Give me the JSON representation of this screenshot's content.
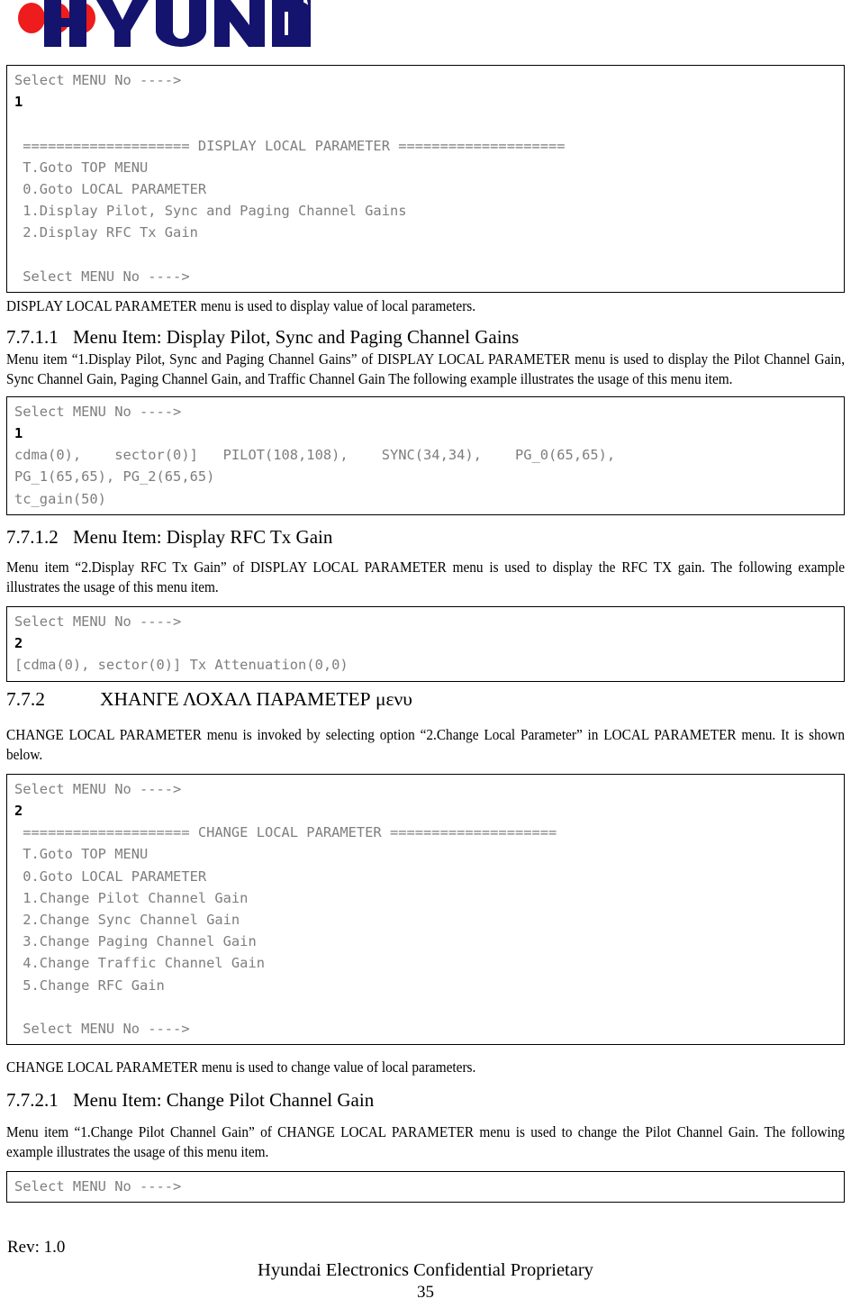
{
  "logo": {
    "wordmark": "HYUNDAI",
    "navy": "#14136e",
    "red": "#ee1c1c"
  },
  "terminal1": {
    "lines": [
      {
        "text": "Select MENU No ---->",
        "style": "dim"
      },
      {
        "text": "1",
        "style": "entry"
      },
      {
        "text": "",
        "style": "dim"
      },
      {
        "text": " ==================== DISPLAY LOCAL PARAMETER ====================",
        "style": "dim"
      },
      {
        "text": " T.Goto TOP MENU",
        "style": "dim"
      },
      {
        "text": " 0.Goto LOCAL PARAMETER",
        "style": "dim"
      },
      {
        "text": " 1.Display Pilot, Sync and Paging Channel Gains",
        "style": "dim"
      },
      {
        "text": " 2.Display RFC Tx Gain",
        "style": "dim"
      },
      {
        "text": "",
        "style": "dim"
      },
      {
        "text": " Select MENU No ---->",
        "style": "dim"
      }
    ]
  },
  "para1": "DISPLAY LOCAL PARAMETER menu is used to display value of local parameters.",
  "heading_7711": {
    "number": "7.7.1.1",
    "title": "Menu Item: Display Pilot, Sync and Paging Channel Gains"
  },
  "para2": "Menu item “1.Display Pilot, Sync and Paging Channel Gains” of DISPLAY LOCAL PARAMETER menu is used to display the Pilot Channel Gain, Sync Channel Gain, Paging Channel Gain, and Traffic Channel Gain The following example illustrates the usage of this menu item.",
  "terminal2": {
    "lines": [
      {
        "text": "Select MENU No ---->",
        "style": "dim"
      },
      {
        "text": "1",
        "style": "entry"
      },
      {
        "text": "cdma(0),    sector(0)]   PILOT(108,108),    SYNC(34,34),    PG_0(65,65),",
        "style": "dim"
      },
      {
        "text": "PG_1(65,65), PG_2(65,65)",
        "style": "dim"
      },
      {
        "text": "tc_gain(50)",
        "style": "dim"
      }
    ]
  },
  "heading_7712": {
    "number": "7.7.1.2",
    "title": "Menu Item: Display RFC Tx Gain"
  },
  "para3": "Menu item “2.Display RFC Tx Gain” of DISPLAY LOCAL PARAMETER menu is used to display the RFC TX gain. The following example illustrates the usage of this menu item.",
  "terminal3": {
    "lines": [
      {
        "text": "Select MENU No ---->",
        "style": "dim"
      },
      {
        "text": "2",
        "style": "entry"
      },
      {
        "text": "[cdma(0), sector(0)] Tx Attenuation(0,0)",
        "style": "dim"
      }
    ]
  },
  "heading_772": {
    "number": "7.7.2",
    "title": "ΧΗΑΝΓΕ ΛΟΧΑΛ ΠΑΡΑΜΕΤΕΡ μενυ"
  },
  "para4": "CHANGE LOCAL PARAMETER menu is invoked by selecting option “2.Change Local Parameter” in LOCAL PARAMETER menu. It is shown below.",
  "terminal4": {
    "lines": [
      {
        "text": "Select MENU No ---->",
        "style": "dim"
      },
      {
        "text": "2",
        "style": "entry"
      },
      {
        "text": " ==================== CHANGE LOCAL PARAMETER ====================",
        "style": "dim"
      },
      {
        "text": " T.Goto TOP MENU",
        "style": "dim"
      },
      {
        "text": " 0.Goto LOCAL PARAMETER",
        "style": "dim"
      },
      {
        "text": " 1.Change Pilot Channel Gain",
        "style": "dim"
      },
      {
        "text": " 2.Change Sync Channel Gain",
        "style": "dim"
      },
      {
        "text": " 3.Change Paging Channel Gain",
        "style": "dim"
      },
      {
        "text": " 4.Change Traffic Channel Gain",
        "style": "dim"
      },
      {
        "text": " 5.Change RFC Gain",
        "style": "dim"
      },
      {
        "text": "",
        "style": "dim"
      },
      {
        "text": " Select MENU No ---->",
        "style": "dim"
      }
    ]
  },
  "para5": "CHANGE LOCAL PARAMETER menu is used to change value of local parameters.",
  "heading_7721": {
    "number": "7.7.2.1",
    "title": "Menu Item: Change Pilot Channel Gain"
  },
  "para6": "Menu item “1.Change Pilot Channel Gain” of CHANGE LOCAL PARAMETER menu is used to change the Pilot Channel Gain. The following example illustrates the usage of this menu item.",
  "terminal5": {
    "lines": [
      {
        "text": "Select MENU No ---->",
        "style": "dim"
      }
    ]
  },
  "footer": {
    "rev": "Rev: 1.0",
    "confidential": "Hyundai Electronics Confidential Proprietary",
    "page_number": "35"
  }
}
